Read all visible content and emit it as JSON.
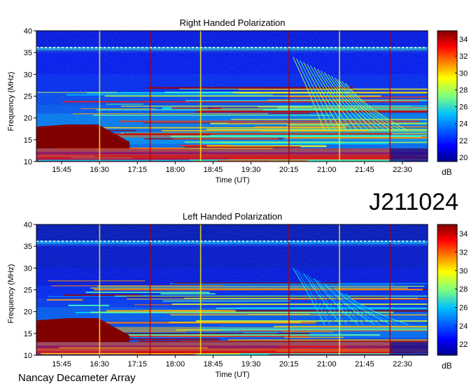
{
  "page": {
    "date_code": "J211024",
    "instrument": "Nancay Decameter Array"
  },
  "chart_data": [
    {
      "type": "heatmap",
      "title": "Right Handed Polarization",
      "xlabel": "Time (UT)",
      "ylabel": "Frequency (MHz)",
      "x_ticks": [
        "15:45",
        "16:30",
        "17:15",
        "18:00",
        "18:45",
        "19:30",
        "20:15",
        "21:00",
        "21:45",
        "22:30"
      ],
      "y_ticks": [
        10,
        15,
        20,
        25,
        30,
        35,
        40
      ],
      "ylim": [
        10,
        40
      ],
      "colorbar": {
        "label": "dB",
        "ticks": [
          20,
          22,
          24,
          26,
          28,
          30,
          32,
          34
        ],
        "range": [
          19.5,
          35
        ]
      },
      "features": [
        {
          "name": "strong emission patch",
          "t_start": "15:15",
          "t_end": "16:45",
          "f_low": 13,
          "f_high": 18.5,
          "db": 35
        },
        {
          "name": "emission arcs",
          "t_start": "19:30",
          "t_end": "21:15",
          "f_low": 17,
          "f_high": 34,
          "db": 28
        },
        {
          "name": "interference band",
          "t_start": "15:15",
          "t_end": "23:00",
          "f_low": 10.5,
          "f_high": 13,
          "db": 33
        }
      ]
    },
    {
      "type": "heatmap",
      "title": "Left Handed Polarization",
      "xlabel": "Time (UT)",
      "ylabel": "Frequency (MHz)",
      "x_ticks": [
        "15:45",
        "16:30",
        "17:15",
        "18:00",
        "18:45",
        "19:30",
        "20:15",
        "21:00",
        "21:45",
        "22:30"
      ],
      "y_ticks": [
        10,
        15,
        20,
        25,
        30,
        35,
        40
      ],
      "ylim": [
        10,
        40
      ],
      "colorbar": {
        "label": "dB",
        "ticks": [
          22,
          24,
          26,
          28,
          30,
          32,
          34
        ],
        "range": [
          20.8,
          35
        ]
      },
      "features": [
        {
          "name": "strong emission patch",
          "t_start": "15:15",
          "t_end": "16:45",
          "f_low": 13,
          "f_high": 18.5,
          "db": 35
        },
        {
          "name": "emission arcs",
          "t_start": "19:30",
          "t_end": "21:15",
          "f_low": 17,
          "f_high": 30,
          "db": 26
        },
        {
          "name": "interference band",
          "t_start": "15:15",
          "t_end": "23:00",
          "f_low": 10.5,
          "f_high": 13,
          "db": 33
        }
      ]
    }
  ]
}
